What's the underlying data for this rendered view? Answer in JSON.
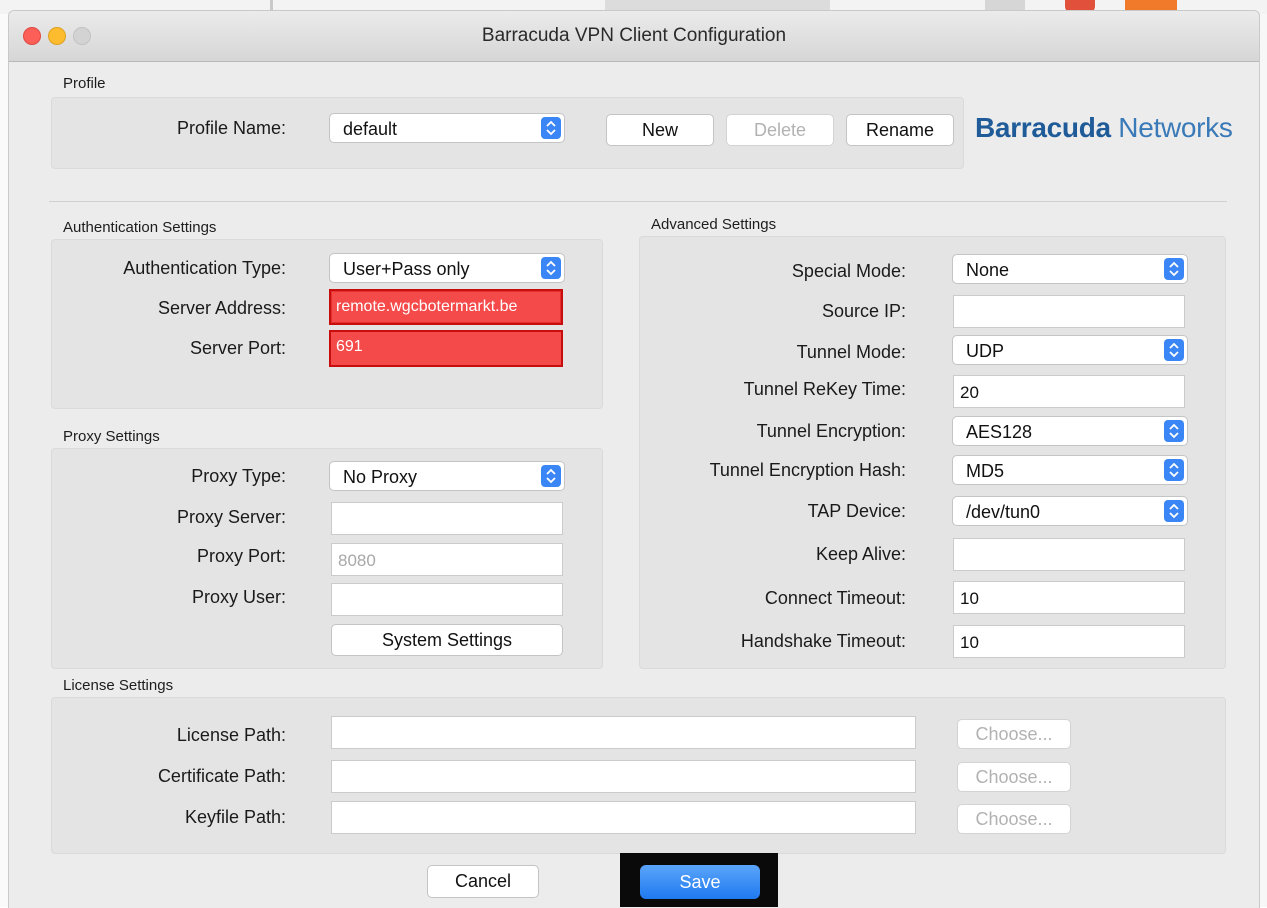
{
  "window": {
    "title": "Barracuda VPN Client Configuration"
  },
  "profile": {
    "section_title": "Profile",
    "name_label": "Profile Name:",
    "name_value": "default",
    "new_label": "New",
    "delete_label": "Delete",
    "rename_label": "Rename",
    "logo_bold": "Barracuda",
    "logo_light": "Networks"
  },
  "auth": {
    "section_title": "Authentication Settings",
    "type_label": "Authentication Type:",
    "type_value": "User+Pass only",
    "server_label": "Server Address:",
    "server_value": "remote.wgcbotermarkt.be",
    "port_label": "Server Port:",
    "port_value": "691"
  },
  "proxy": {
    "section_title": "Proxy Settings",
    "type_label": "Proxy Type:",
    "type_value": "No Proxy",
    "server_label": "Proxy Server:",
    "server_value": "",
    "port_label": "Proxy Port:",
    "port_placeholder": "8080",
    "user_label": "Proxy User:",
    "user_value": "",
    "system_settings_label": "System Settings"
  },
  "advanced": {
    "section_title": "Advanced Settings",
    "special_mode_label": "Special Mode:",
    "special_mode_value": "None",
    "source_ip_label": "Source IP:",
    "source_ip_value": "",
    "tunnel_mode_label": "Tunnel Mode:",
    "tunnel_mode_value": "UDP",
    "rekey_label": "Tunnel ReKey Time:",
    "rekey_value": "20",
    "encryption_label": "Tunnel Encryption:",
    "encryption_value": "AES128",
    "hash_label": "Tunnel Encryption Hash:",
    "hash_value": "MD5",
    "tap_label": "TAP Device:",
    "tap_value": "/dev/tun0",
    "keepalive_label": "Keep Alive:",
    "keepalive_value": "",
    "connect_timeout_label": "Connect Timeout:",
    "connect_timeout_value": "10",
    "handshake_timeout_label": "Handshake Timeout:",
    "handshake_timeout_value": "10"
  },
  "license": {
    "section_title": "License Settings",
    "license_path_label": "License Path:",
    "certificate_path_label": "Certificate Path:",
    "keyfile_path_label": "Keyfile Path:",
    "choose_label": "Choose..."
  },
  "footer": {
    "cancel_label": "Cancel",
    "save_label": "Save"
  },
  "colors": {
    "accent": "#3b86f6",
    "highlight_red": "#f44a4a",
    "logo_blue": "#1f5b98"
  }
}
